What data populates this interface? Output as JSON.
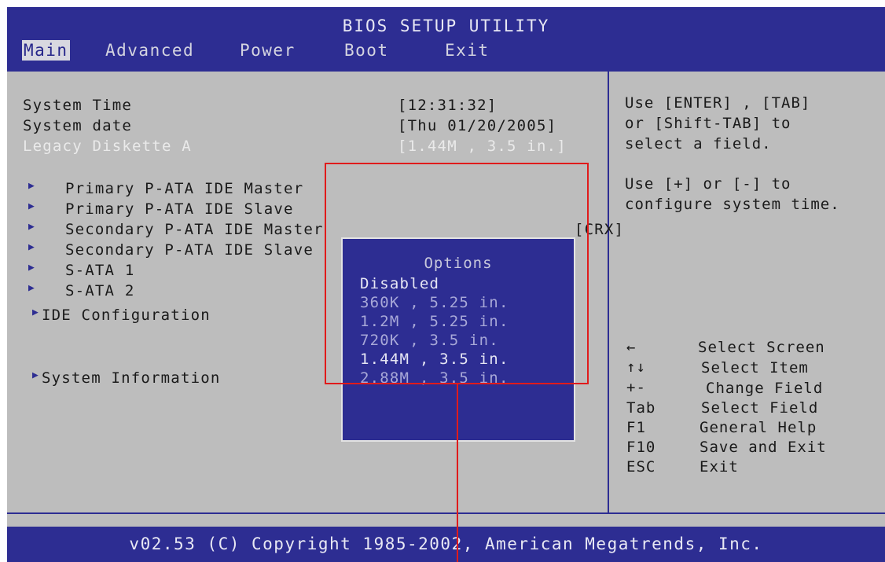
{
  "header": {
    "title": "BIOS SETUP UTILITY",
    "menu": [
      {
        "label": "Main",
        "active": true
      },
      {
        "label": "Advanced",
        "active": false
      },
      {
        "label": "Power",
        "active": false
      },
      {
        "label": "Boot",
        "active": false
      },
      {
        "label": "Exit",
        "active": false
      }
    ]
  },
  "main": {
    "settings": [
      {
        "label": "System Time",
        "value": "[12:31:32]"
      },
      {
        "label": "System date",
        "value": "[Thu 01/20/2005]"
      },
      {
        "label": "Legacy Diskette A",
        "value": "[1.44M , 3.5 in.]"
      }
    ],
    "submenus": [
      "Primary P-ATA IDE Master",
      "Primary P-ATA IDE Slave",
      "Secondary P-ATA IDE Master",
      "Secondary P-ATA IDE Slave",
      "S-ATA 1",
      "S-ATA 2"
    ],
    "secondary_master_suffix": "[CRX]",
    "ide_configuration": "IDE Configuration",
    "system_information": "System Information"
  },
  "popup": {
    "title": "Options",
    "options": [
      "Disabled",
      "360K , 5.25 in.",
      "1.2M , 5.25 in.",
      "720K , 3.5 in.",
      "1.44M , 3.5 in.",
      "2.88M , 3.5 in."
    ],
    "bright_options": [
      0,
      4
    ]
  },
  "help": {
    "text1": [
      "Use [ENTER] , [TAB]",
      "or [Shift-TAB] to",
      "select a field."
    ],
    "text2": [
      "Use [+] or [-] to",
      "configure system time."
    ],
    "keys": [
      {
        "key": "←",
        "desc": "Select Screen"
      },
      {
        "key": "↑↓",
        "desc": "Select Item"
      },
      {
        "key": "+-",
        "desc": "Change Field"
      },
      {
        "key": "Tab",
        "desc": "Select Field"
      },
      {
        "key": "F1",
        "desc": "General Help"
      },
      {
        "key": "F10",
        "desc": "Save and Exit"
      },
      {
        "key": "ESC",
        "desc": "Exit"
      }
    ]
  },
  "footer": "v02.53 (C) Copyright 1985-2002, American Megatrends, Inc.",
  "colors": {
    "bios_blue": "#2d2d92",
    "panel_gray": "#bdbdbd",
    "annotation_red": "#e01b1b"
  }
}
